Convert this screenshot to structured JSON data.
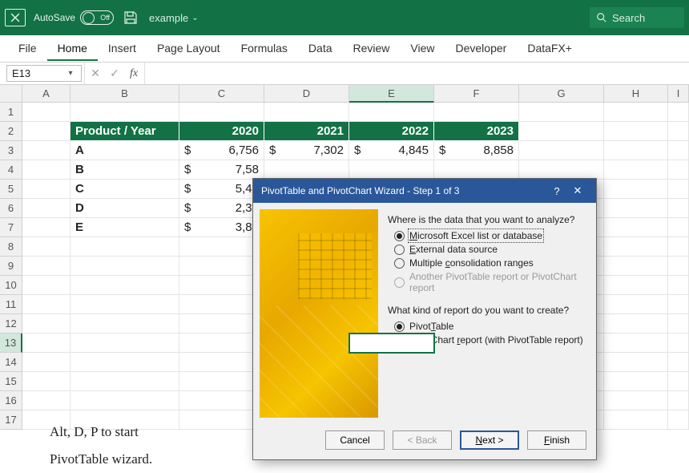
{
  "titlebar": {
    "autosave_label": "AutoSave",
    "autosave_state": "Off",
    "filename": "example",
    "search_placeholder": "Search"
  },
  "ribbon": {
    "tabs": [
      "File",
      "Home",
      "Insert",
      "Page Layout",
      "Formulas",
      "Data",
      "Review",
      "View",
      "Developer",
      "DataFX+"
    ],
    "active": "Home"
  },
  "formula_bar": {
    "name_box": "E13",
    "fx_label": "fx",
    "formula": ""
  },
  "grid": {
    "columns": [
      "A",
      "B",
      "C",
      "D",
      "E",
      "F",
      "G",
      "H",
      "I"
    ],
    "row_count": 17,
    "selected_cell": "E13",
    "header_row": {
      "product_year": "Product  / Year",
      "years": [
        "2020",
        "2021",
        "2022",
        "2023"
      ]
    },
    "rows": [
      {
        "product": "A",
        "values": [
          "6,756",
          "7,302",
          "4,845",
          "8,858"
        ]
      },
      {
        "product": "B",
        "values": [
          "7,58",
          "",
          "",
          ""
        ]
      },
      {
        "product": "C",
        "values": [
          "5,47",
          "",
          "",
          ""
        ]
      },
      {
        "product": "D",
        "values": [
          "2,30",
          "",
          "",
          ""
        ]
      },
      {
        "product": "E",
        "values": [
          "3,87",
          "",
          "",
          ""
        ]
      }
    ],
    "currency": "$",
    "note_line1": "Alt, D, P to start",
    "note_line2": "PivotTable wizard."
  },
  "wizard": {
    "title": "PivotTable and PivotChart Wizard - Step 1 of 3",
    "q1": "Where is the data that you want to analyze?",
    "opts1": [
      {
        "label_pre": "",
        "u": "M",
        "label_post": "icrosoft Excel list or database",
        "checked": true,
        "disabled": false,
        "boxed": true
      },
      {
        "label_pre": "",
        "u": "E",
        "label_post": "xternal data source",
        "checked": false,
        "disabled": false
      },
      {
        "label_pre": "Multiple ",
        "u": "c",
        "label_post": "onsolidation ranges",
        "checked": false,
        "disabled": false
      },
      {
        "label_pre": "Another PivotTable report or PivotChart report",
        "u": "",
        "label_post": "",
        "checked": false,
        "disabled": true
      }
    ],
    "q2": "What kind of report do you want to create?",
    "opts2": [
      {
        "label_pre": "Pivot",
        "u": "T",
        "label_post": "able",
        "checked": true
      },
      {
        "label_pre": "PivotChart ",
        "u": "r",
        "label_post": "eport (with PivotTable report)",
        "checked": false
      }
    ],
    "buttons": {
      "cancel": "Cancel",
      "back": "< Back",
      "next": "Next >",
      "finish": "Finish"
    }
  }
}
